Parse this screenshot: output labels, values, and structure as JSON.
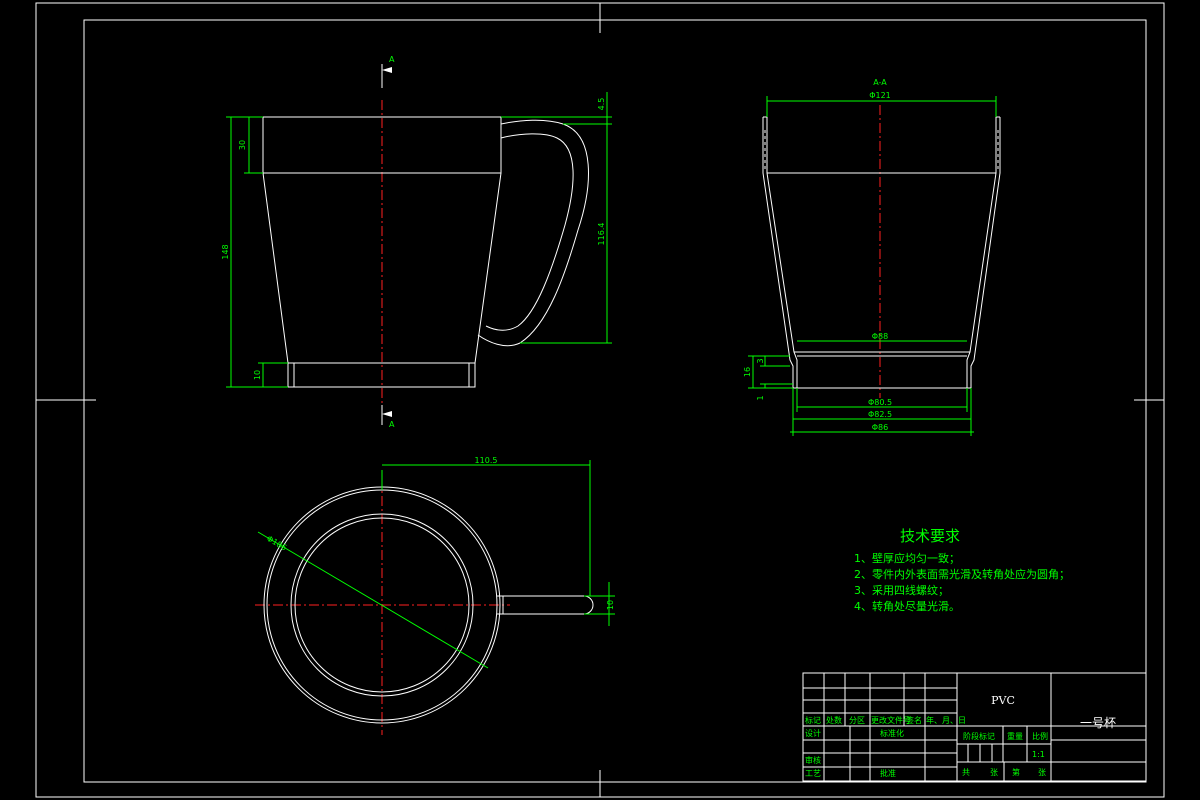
{
  "section_mark": "A",
  "section_view_label": "A-A",
  "front_view": {
    "dims": {
      "total_height": "148",
      "rim_height": "30",
      "base_height": "10",
      "handle_top": "4.5",
      "handle_height": "116.4"
    }
  },
  "section_view": {
    "dims": {
      "top_diameter": "Φ121",
      "inner_bottom": "Φ88",
      "step_small_a": "3",
      "step_total": "16",
      "step_small_b": "1",
      "base_inner": "Φ80.5",
      "base_mid": "Φ82.5",
      "base_outer": "Φ86"
    }
  },
  "top_view": {
    "dims": {
      "handle_reach": "110.5",
      "diameter": "Φ186",
      "handle_width": "10"
    }
  },
  "tech_req": {
    "title": "技术要求",
    "items": [
      "1、壁厚应均匀一致；",
      "2、零件内外表面需光滑及转角处应为圆角；",
      "3、采用四线螺纹；",
      "4、转角处尽量光滑。"
    ]
  },
  "title_block": {
    "material": "PVC",
    "part_name": "一号杯",
    "scale": "1:1",
    "row_labels": [
      "标记",
      "处数",
      "分区",
      "更改文件号",
      "签名",
      "年、月、日"
    ],
    "design": "设计",
    "standardize": "标准化",
    "stage_mark": "阶段标记",
    "weight": "重量",
    "scale_label": "比例",
    "review": "审核",
    "process": "工艺",
    "approve": "批准",
    "sheets_total": "共",
    "sheet_unit_a": "张",
    "sheet_no": "第",
    "sheet_unit_b": "张"
  }
}
